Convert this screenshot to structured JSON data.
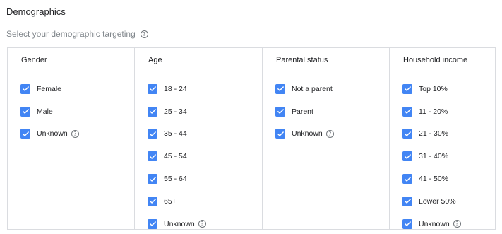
{
  "title": "Demographics",
  "subtitle": "Select your demographic targeting",
  "colors": {
    "checkbox": "#4285f4",
    "border": "#dadce0",
    "muted": "#80868b"
  },
  "icons": {
    "checkbox": "check-icon",
    "help": "help-circle-icon"
  },
  "columns": [
    {
      "title": "Gender",
      "options": [
        {
          "label": "Female",
          "checked": true,
          "help": false
        },
        {
          "label": "Male",
          "checked": true,
          "help": false
        },
        {
          "label": "Unknown",
          "checked": true,
          "help": true
        }
      ]
    },
    {
      "title": "Age",
      "options": [
        {
          "label": "18 - 24",
          "checked": true,
          "help": false
        },
        {
          "label": "25 - 34",
          "checked": true,
          "help": false
        },
        {
          "label": "35 - 44",
          "checked": true,
          "help": false
        },
        {
          "label": "45 - 54",
          "checked": true,
          "help": false
        },
        {
          "label": "55 - 64",
          "checked": true,
          "help": false
        },
        {
          "label": "65+",
          "checked": true,
          "help": false
        },
        {
          "label": "Unknown",
          "checked": true,
          "help": true
        }
      ]
    },
    {
      "title": "Parental status",
      "options": [
        {
          "label": "Not a parent",
          "checked": true,
          "help": false
        },
        {
          "label": "Parent",
          "checked": true,
          "help": false
        },
        {
          "label": "Unknown",
          "checked": true,
          "help": true
        }
      ]
    },
    {
      "title": "Household income",
      "options": [
        {
          "label": "Top 10%",
          "checked": true,
          "help": false
        },
        {
          "label": "11 - 20%",
          "checked": true,
          "help": false
        },
        {
          "label": "21 - 30%",
          "checked": true,
          "help": false
        },
        {
          "label": "31 - 40%",
          "checked": true,
          "help": false
        },
        {
          "label": "41 - 50%",
          "checked": true,
          "help": false
        },
        {
          "label": "Lower 50%",
          "checked": true,
          "help": false
        },
        {
          "label": "Unknown",
          "checked": true,
          "help": true
        }
      ]
    }
  ]
}
